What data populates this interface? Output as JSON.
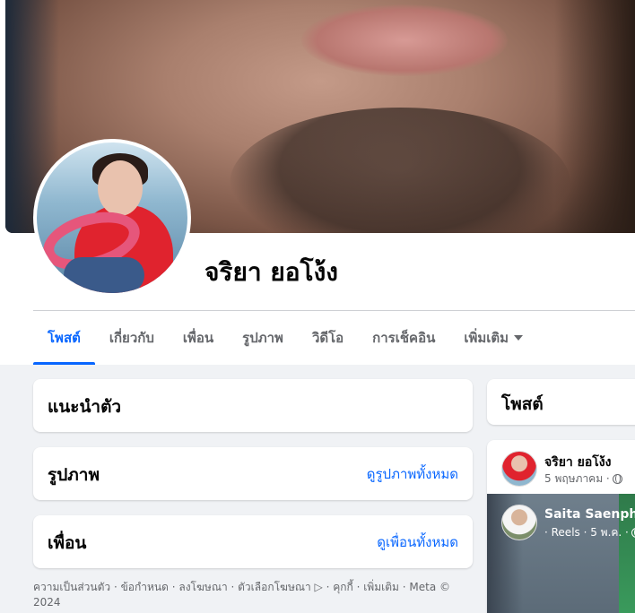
{
  "profile": {
    "name": "จริยา ยอโง้ง"
  },
  "tabs": [
    {
      "label": "โพสต์",
      "active": true
    },
    {
      "label": "เกี่ยวกับ",
      "active": false
    },
    {
      "label": "เพื่อน",
      "active": false
    },
    {
      "label": "รูปภาพ",
      "active": false
    },
    {
      "label": "วิดีโอ",
      "active": false
    },
    {
      "label": "การเช็คอิน",
      "active": false
    },
    {
      "label": "เพิ่มเติม",
      "active": false
    }
  ],
  "left": {
    "intro_title": "แนะนำตัว",
    "photos_title": "รูปภาพ",
    "photos_link": "ดูรูปภาพทั้งหมด",
    "friends_title": "เพื่อน",
    "friends_link": "ดูเพื่อนทั้งหมด",
    "footer": "ความเป็นส่วนตัว · ข้อกำหนด · ลงโฆษณา · ตัวเลือกโฆษณา ▷ · คุกกี้ · เพิ่มเติม · Meta © 2024"
  },
  "right": {
    "posts_title": "โพสต์",
    "post": {
      "author": "จริยา ยอโง้ง",
      "date": "5 พฤษภาคม ·",
      "shared_author": "Saita Saenphon",
      "shared_meta": "· Reels · 5 พ.ค. ·"
    }
  },
  "colors": {
    "accent": "#0866ff",
    "background": "#f0f2f5",
    "muted_text": "#65676b"
  },
  "icons": [
    "dropdown-caret-icon",
    "globe-icon"
  ]
}
